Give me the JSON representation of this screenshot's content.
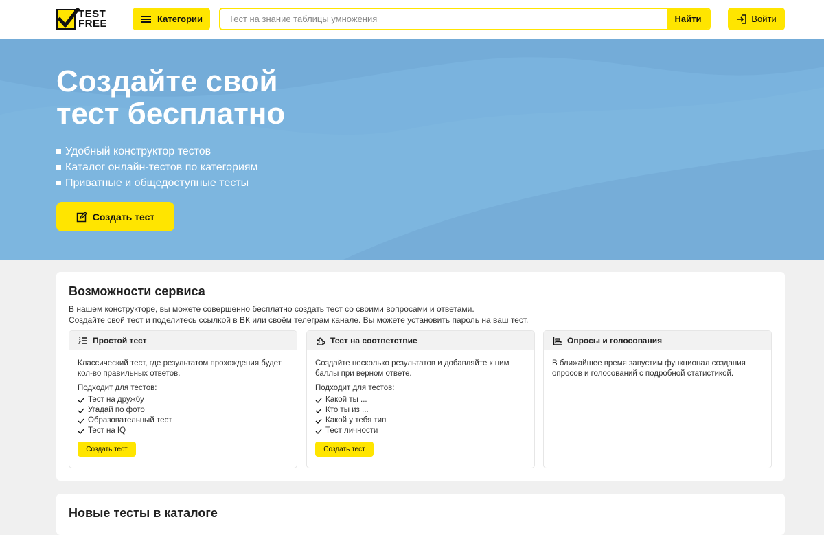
{
  "header": {
    "logo_line1": "TEST",
    "logo_line2": "FREE",
    "categories_label": "Категории",
    "search_placeholder": "Тест на знание таблицы умножения",
    "search_value": "",
    "find_label": "Найти",
    "login_label": "Войти"
  },
  "hero": {
    "title_line1": "Создайте свой",
    "title_line2": "тест бесплатно",
    "bullets": [
      "Удобный конструктор тестов",
      "Каталог онлайн-тестов по категориям",
      "Приватные и общедоступные тесты"
    ],
    "create_label": "Создать тест"
  },
  "features": {
    "title": "Возможности сервиса",
    "desc_line1": "В нашем конструкторе, вы можете совершенно бесплатно создать тест со своими вопросами и ответами.",
    "desc_line2": "Создайте свой тест и поделитесь ссылкой в ВК или своём телеграм канале. Вы можете установить пароль на ваш тест.",
    "cards": [
      {
        "title": "Простой тест",
        "icon": "list-numbered-icon",
        "text": "Классический тест, где результатом прохождения будет кол-во правильных ответов.",
        "suits": "Подходит для тестов:",
        "items": [
          "Тест на дружбу",
          "Угадай по фото",
          "Образовательный тест",
          "Тест на IQ"
        ],
        "button": "Создать тест"
      },
      {
        "title": "Тест на соответствие",
        "icon": "puzzle-icon",
        "text": "Создайте несколько результатов и добавляйте к ним баллы при верном ответе.",
        "suits": "Подходит для тестов:",
        "items": [
          "Какой ты ...",
          "Кто ты из ...",
          "Какой у тебя тип",
          "Тест личности"
        ],
        "button": "Создать тест"
      },
      {
        "title": "Опросы и голосования",
        "icon": "bar-chart-icon",
        "text": "В ближайшее время запустим функционал создания опросов и голосований с подробной статистикой."
      }
    ]
  },
  "catalog": {
    "title": "Новые тесты в каталоге"
  },
  "colors": {
    "accent": "#ffe500",
    "hero_bg": "#79b1db",
    "page_bg": "#f0f0f0"
  }
}
